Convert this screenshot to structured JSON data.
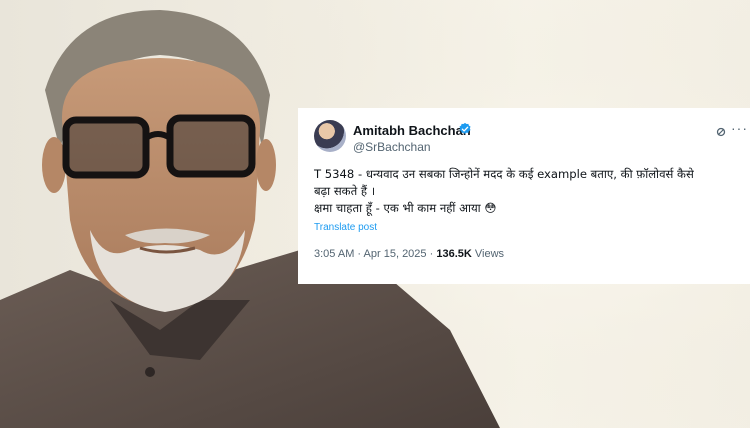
{
  "tweet": {
    "author_name": "Amitabh Bachchan",
    "handle": "@SrBachchan",
    "text_lines": [
      "T 5348 - धन्यवाद उन सबका जिन्होनें मदद के कई example बताए, की फ़ॉलोवर्स कैसे",
      "बढ़ा सकते हैं ।",
      "क्षमा चाहता हूँ - एक भी काम नहीं आया 😳"
    ],
    "translate_label": "Translate post",
    "time": "3:05 AM",
    "date": "Apr 15, 2025",
    "separator": "·",
    "views_count": "136.5K",
    "views_label": "Views",
    "more_icon": "more-icon",
    "verified_color": "#1d9bf0"
  }
}
